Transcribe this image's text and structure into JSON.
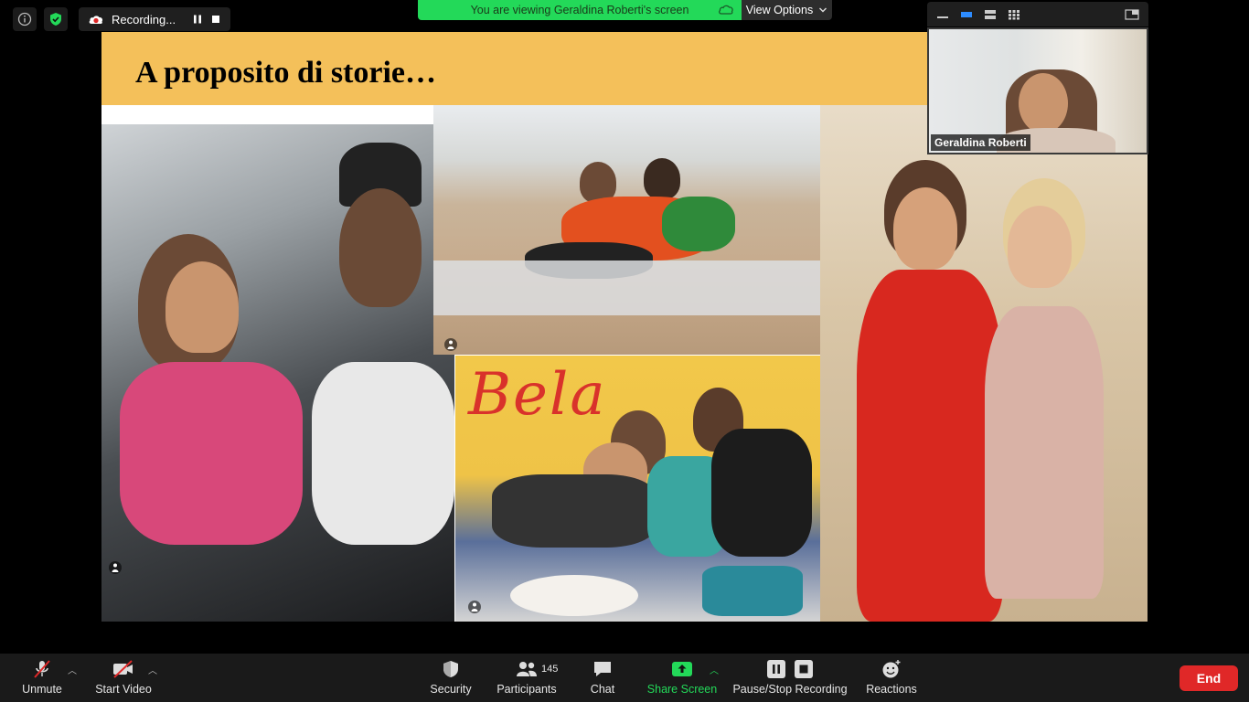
{
  "top_controls": {
    "recording_label": "Recording...",
    "colors": {
      "shield": "#23d959",
      "record_dot": "#e02828"
    }
  },
  "banner": {
    "viewing_text": "You are viewing Geraldina Roberti's screen",
    "view_options_label": "View Options",
    "color": "#23d959"
  },
  "slide": {
    "title": "A proposito di storie…",
    "header_color": "#f4c05a",
    "poster_text": "Bela"
  },
  "participant_thumb": {
    "name": "Geraldina Roberti"
  },
  "toolbar": {
    "unmute_label": "Unmute",
    "start_video_label": "Start Video",
    "security_label": "Security",
    "participants_label": "Participants",
    "participants_count": "145",
    "chat_label": "Chat",
    "share_screen_label": "Share Screen",
    "recording_label": "Pause/Stop Recording",
    "reactions_label": "Reactions",
    "end_label": "End",
    "colors": {
      "share_screen": "#23d959",
      "end": "#e02828"
    }
  }
}
